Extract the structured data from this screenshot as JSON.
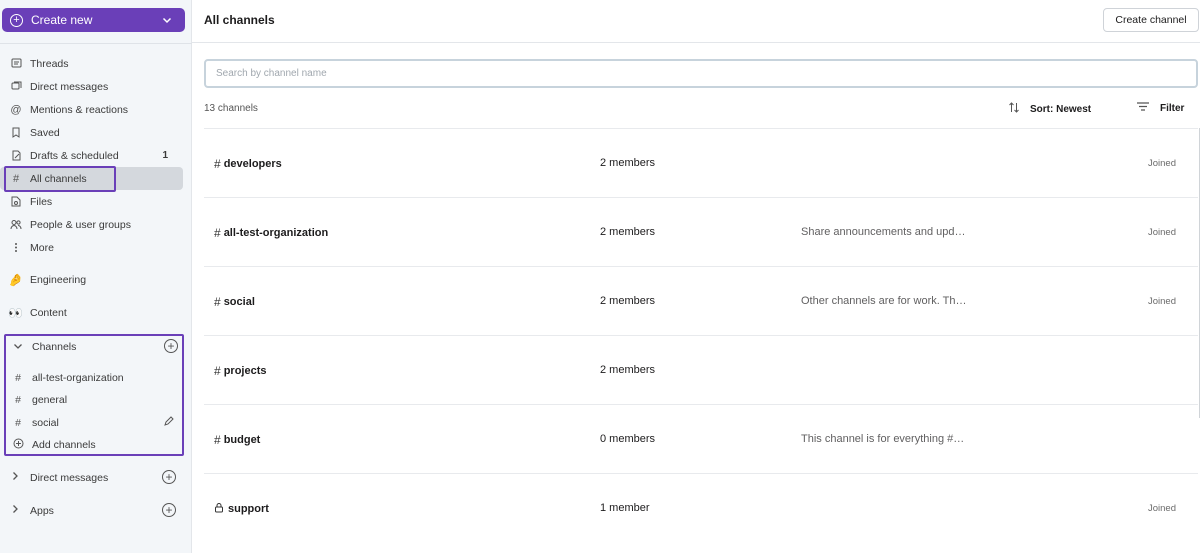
{
  "sidebar": {
    "create_label": "Create new",
    "nav": [
      {
        "label": "Threads",
        "icon": "threads-icon"
      },
      {
        "label": "Direct messages",
        "icon": "direct-messages-icon"
      },
      {
        "label": "Mentions & reactions",
        "icon": "at-icon"
      },
      {
        "label": "Saved",
        "icon": "bookmark-icon"
      },
      {
        "label": "Drafts & scheduled",
        "icon": "draft-icon",
        "count": "1"
      },
      {
        "label": "All channels",
        "icon": "channels-search-icon"
      },
      {
        "label": "Files",
        "icon": "files-icon"
      },
      {
        "label": "People & user groups",
        "icon": "people-icon"
      },
      {
        "label": "More",
        "icon": "more-vertical-icon"
      }
    ],
    "sections": [
      {
        "label": "Engineering",
        "emoji": "🤌"
      },
      {
        "label": "Content",
        "emoji": "👀"
      }
    ],
    "channels_header": "Channels",
    "channels": [
      {
        "name": "all-test-organization"
      },
      {
        "name": "general"
      },
      {
        "name": "social"
      }
    ],
    "add_channels_label": "Add channels",
    "direct_messages_label": "Direct messages",
    "apps_label": "Apps"
  },
  "main": {
    "title": "All channels",
    "create_channel_label": "Create channel",
    "search_placeholder": "Search by channel name",
    "channel_count": "13 channels",
    "sort_label": "Sort: Newest",
    "filter_label": "Filter",
    "rows": [
      {
        "name": "developers",
        "members": "2 members",
        "description": "",
        "status": "Joined",
        "private": false
      },
      {
        "name": "all-test-organization",
        "members": "2 members",
        "description": "Share announcements and upd…",
        "status": "Joined",
        "private": false
      },
      {
        "name": "social",
        "members": "2 members",
        "description": "Other channels are for work. Th…",
        "status": "Joined",
        "private": false
      },
      {
        "name": "projects",
        "members": "2 members",
        "description": "",
        "status": "",
        "private": false
      },
      {
        "name": "budget",
        "members": "0 members",
        "description": "This channel is for everything #…",
        "status": "",
        "private": false
      },
      {
        "name": "support",
        "members": "1 member",
        "description": "",
        "status": "Joined",
        "private": true
      }
    ]
  },
  "colors": {
    "accent": "#6a3fb8",
    "sidebar_bg": "#f3f6f9",
    "active_item_bg": "#d4d8dd"
  }
}
